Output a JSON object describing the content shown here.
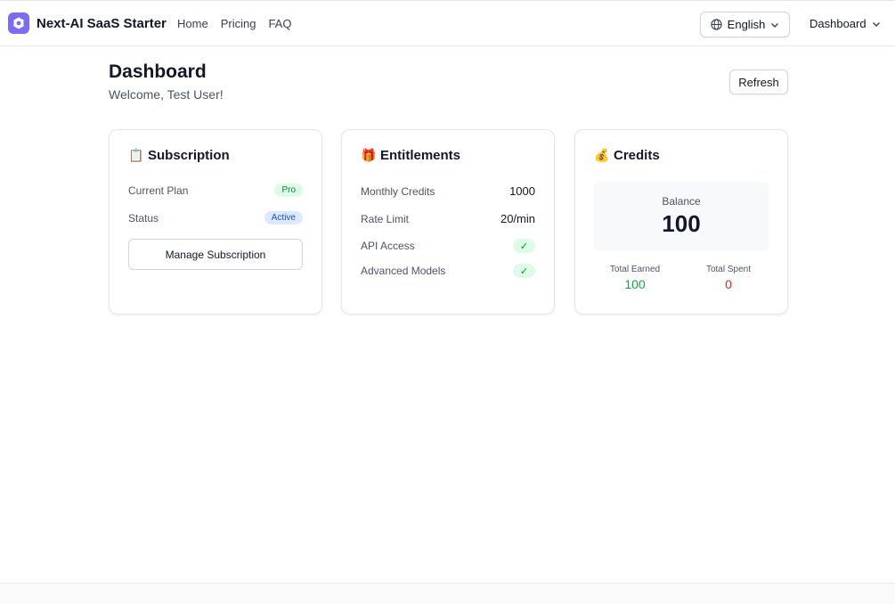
{
  "header": {
    "brand": "Next-AI SaaS Starter",
    "nav": [
      "Home",
      "Pricing",
      "FAQ"
    ],
    "language": "English",
    "dashboard_menu": "Dashboard"
  },
  "page": {
    "title": "Dashboard",
    "welcome": "Welcome, Test User!",
    "refresh_label": "Refresh"
  },
  "subscription": {
    "title": "Subscription",
    "icon": "clipboard-icon",
    "current_plan_label": "Current Plan",
    "current_plan_value": "Pro",
    "status_label": "Status",
    "status_value": "Active",
    "manage_label": "Manage Subscription"
  },
  "entitlements": {
    "title": "Entitlements",
    "icon": "gift-icon",
    "monthly_credits_label": "Monthly Credits",
    "monthly_credits_value": "1000",
    "rate_limit_label": "Rate Limit",
    "rate_limit_value": "20/min",
    "api_access_label": "API Access",
    "api_access_value": "✓",
    "advanced_models_label": "Advanced Models",
    "advanced_models_value": "✓"
  },
  "credits": {
    "title": "Credits",
    "icon": "money-bag-icon",
    "balance_label": "Balance",
    "balance_value": "100",
    "earned_label": "Total Earned",
    "earned_value": "100",
    "spent_label": "Total Spent",
    "spent_value": "0"
  },
  "colors": {
    "accent": "#7c6cf2",
    "success": "#16a34a",
    "danger": "#dc2626",
    "info": "#1d4ed8"
  }
}
